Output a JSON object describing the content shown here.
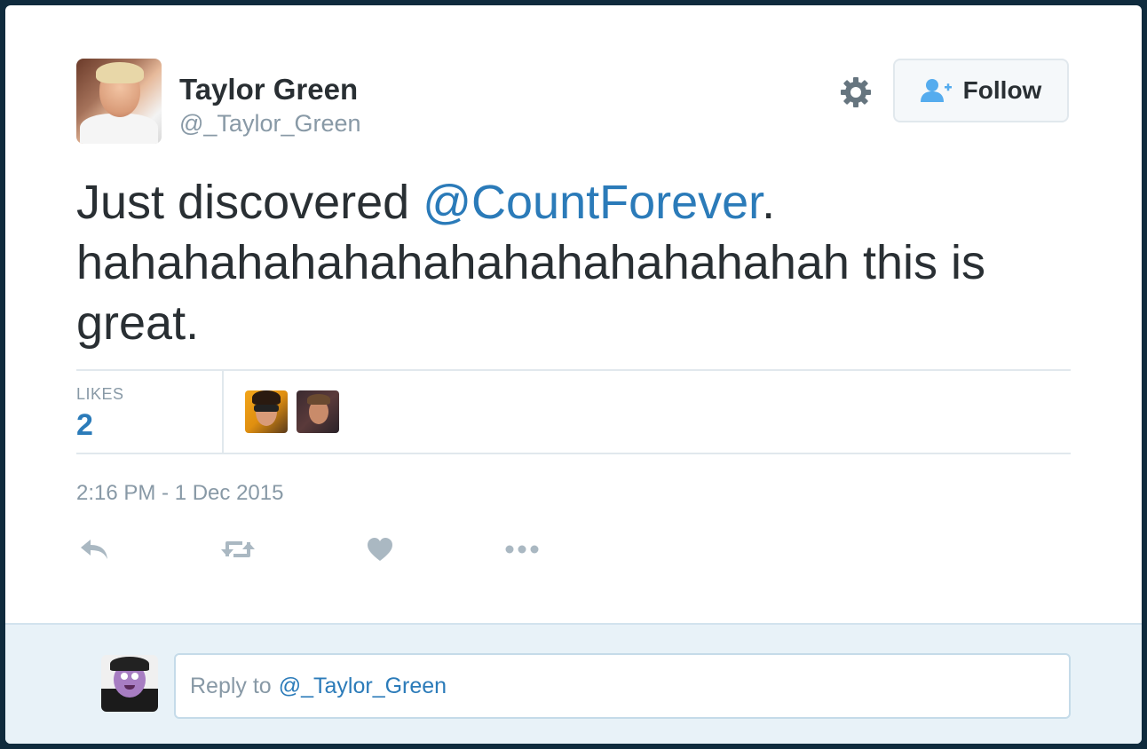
{
  "tweet": {
    "author_name": "Taylor Green",
    "author_handle": "@_Taylor_Green",
    "text_before": "Just discovered ",
    "mention": "@CountForever",
    "text_after": ". hahahahahahahahahahahahahahah this is great.",
    "timestamp": "2:16 PM - 1 Dec 2015"
  },
  "header": {
    "follow_label": "Follow",
    "gear_icon": "gear-icon",
    "follow_icon": "add-user-icon"
  },
  "stats": {
    "likes_label": "LIKES",
    "likes_count": "2"
  },
  "actions": [
    {
      "icon": "reply-icon"
    },
    {
      "icon": "retweet-icon"
    },
    {
      "icon": "heart-icon"
    },
    {
      "icon": "more-icon"
    }
  ],
  "reply": {
    "placeholder_prefix": "Reply to",
    "placeholder_mention": "@_Taylor_Green"
  },
  "colors": {
    "accent": "#2b7bb9",
    "text": "#292f33",
    "muted": "#8899a6",
    "reply_bar": "#e8f2f8"
  }
}
